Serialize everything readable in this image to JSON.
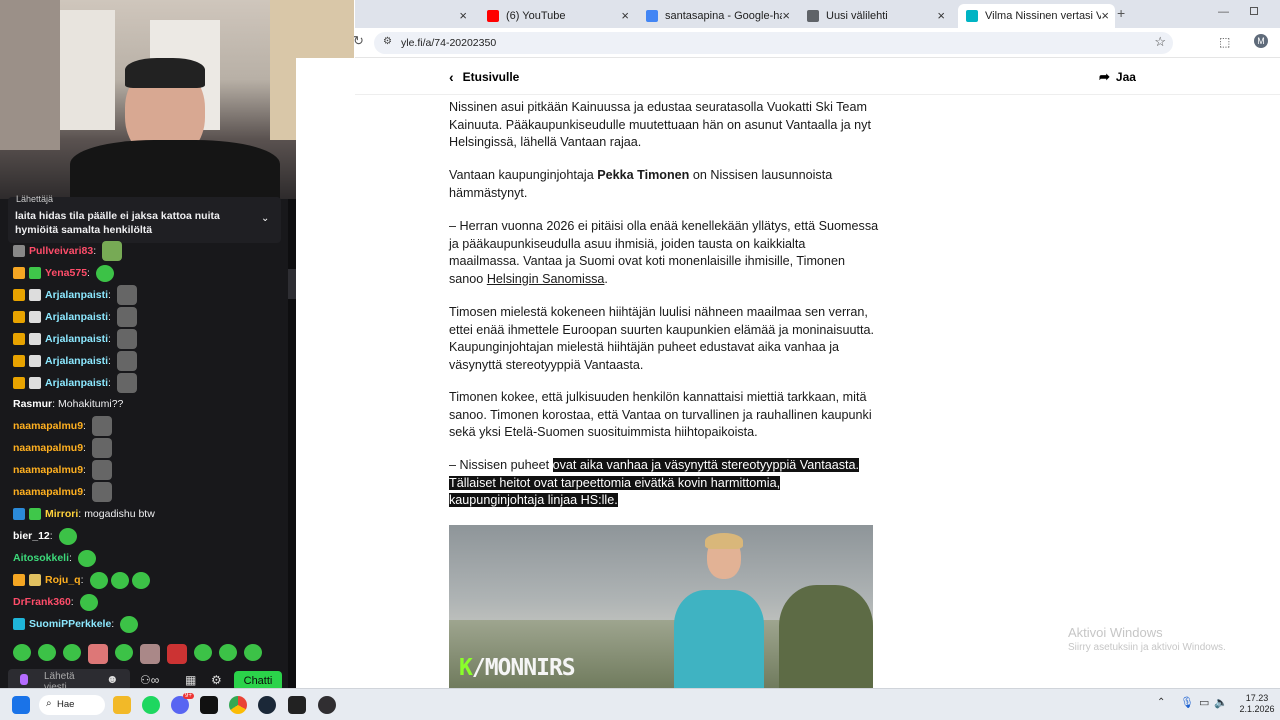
{
  "browser": {
    "tabs": [
      {
        "label": "",
        "favicon_color": "#dfe3eb"
      },
      {
        "label": "(6) YouTube",
        "favicon_color": "#ff0000"
      },
      {
        "label": "santasapina - Google-haku",
        "favicon_color": "#4285f4"
      },
      {
        "label": "Uusi välilehti",
        "favicon_color": "#5f6368"
      },
      {
        "label": "Vilma Nissinen vertasi Vantaata",
        "favicon_color": "#00b4c4"
      }
    ],
    "new_tab_symbol": "+",
    "url": "yle.fi/a/74-20202350",
    "profile_initial": "M"
  },
  "chat": {
    "pinned_header": "Lähettäjä",
    "pinned_message": "laita hidas tila päälle ei jaksa kattoa nuita hymiöitä samalta henkilöltä",
    "messages": [
      {
        "user": "Pullveivari83",
        "text": "",
        "color": "#ff4d6a"
      },
      {
        "user": "Yena575",
        "text": "",
        "color": "#ff4d6a"
      },
      {
        "user": "Arjalanpaisti",
        "text": "",
        "color": "#8ce8ff"
      },
      {
        "user": "Arjalanpaisti",
        "text": "",
        "color": "#8ce8ff"
      },
      {
        "user": "Arjalanpaisti",
        "text": "",
        "color": "#8ce8ff"
      },
      {
        "user": "Arjalanpaisti",
        "text": "",
        "color": "#8ce8ff"
      },
      {
        "user": "Arjalanpaisti",
        "text": "",
        "color": "#8ce8ff"
      },
      {
        "user": "Rasmur",
        "text": "Mohakitumi??",
        "color": "#ffffff"
      },
      {
        "user": "naamapalmu9",
        "text": "",
        "color": "#ffb020"
      },
      {
        "user": "naamapalmu9",
        "text": "",
        "color": "#ffb020"
      },
      {
        "user": "naamapalmu9",
        "text": "",
        "color": "#ffb020"
      },
      {
        "user": "naamapalmu9",
        "text": "",
        "color": "#ffb020"
      },
      {
        "user": "Mirrori",
        "text": "mogadishu btw",
        "color": "#ffd23c"
      },
      {
        "user": "bier_12",
        "text": "",
        "color": "#ffffff"
      },
      {
        "user": "Aitosokkeli",
        "text": "",
        "color": "#3cd97a"
      },
      {
        "user": "Roju_q",
        "text": "",
        "color": "#ffb020"
      },
      {
        "user": "DrFrank360",
        "text": "",
        "color": "#ff4d6a"
      },
      {
        "user": "SuomiPPerkkele",
        "text": "",
        "color": "#8ce8ff"
      }
    ],
    "input_placeholder": "Lähetä viesti",
    "chat_button": "Chatti",
    "accent_color": "#2bd34a"
  },
  "article": {
    "back_label": "Etusivulle",
    "share_label": "Jaa",
    "p1": "Nissinen asui pitkään Kainuussa ja edustaa seuratasolla Vuokatti Ski Team Kainuuta. Pääkaupunkiseudulle muutettuaan hän on asunut Vantaalla ja nyt Helsingissä, lähellä Vantaan rajaa.",
    "p2_pre": "Vantaan kaupunginjohtaja ",
    "p2_bold": "Pekka Timonen",
    "p2_post": " on Nissisen lausunnoista hämmästynyt.",
    "p3_pre": "– Herran vuonna 2026 ei pitäisi olla enää kenellekään yllätys, että Suomessa ja pääkaupunkiseudulla asuu ihmisiä, joiden tausta on kaikkialta maailmassa. Vantaa ja Suomi ovat koti monenlaisille ihmisille, Timonen sanoo ",
    "p3_link": "Helsingin Sanomissa",
    "p3_post": ".",
    "p4": "Timosen mielestä kokeneen hiihtäjän luulisi nähneen maailmaa sen verran, ettei enää ihmettele Euroopan suurten kaupunkien elämää ja moninaisuutta. Kaupunginjohtajan mielestä hiihtäjän puheet edustavat aika vanhaa ja väsynyttä stereotyyppiä Vantaasta.",
    "p5": "Timonen kokee, että julkisuuden henkilön kannattaisi miettiä tarkkaan, mitä sanoo. Timonen korostaa, että Vantaa on turvallinen ja rauhallinen kaupunki sekä yksi Etelä-Suomen suosituimmista hiihtopaikoista.",
    "p6_plain": "– Nissisen puheet ",
    "p6_sel1": "ovat aika vanhaa ja väsynyttä stereotyyppiä Vantaasta.",
    "p6_sel2": "Tällaiset heitot ovat tarpeettomia eivätkä kovin harmittomia,",
    "p6_sel3": "kaupunginjohtaja linjaa HS:lle.",
    "photo_watermark": "K/MONNIRS"
  },
  "windows": {
    "activate_title": "Aktivoi Windows",
    "activate_sub": "Siirry asetuksiin ja aktivoi Windows.",
    "search_label": "Hae",
    "time": "17.23",
    "date": "2.1.2026",
    "discord_badge": "9+"
  }
}
